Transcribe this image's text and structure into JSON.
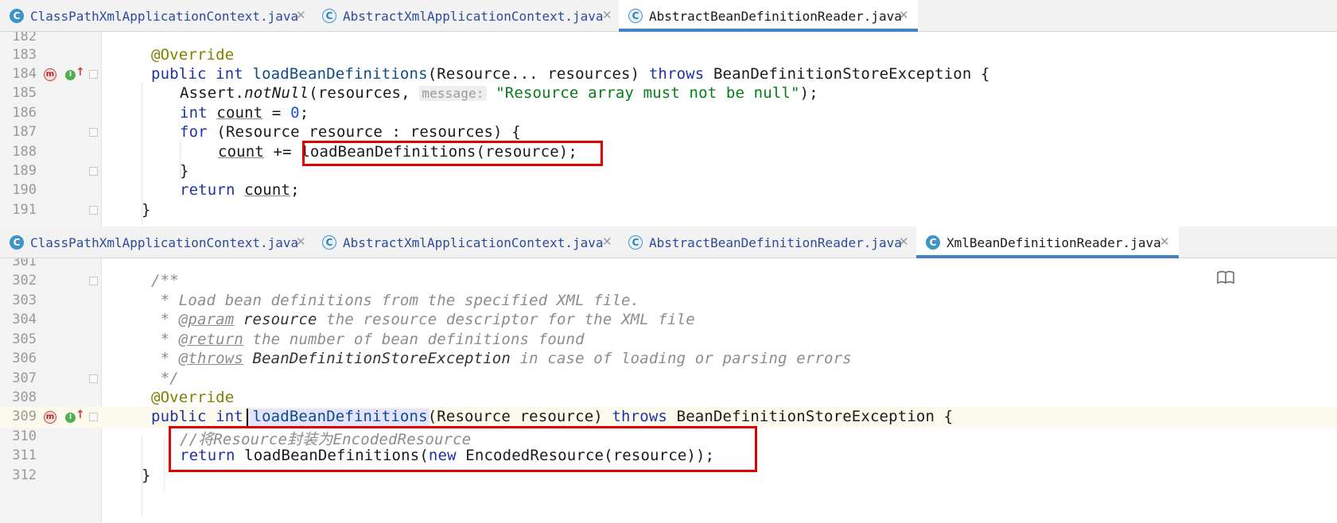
{
  "top_tabs": [
    {
      "label": "ClassPathXmlApplicationContext.java",
      "icon": "C",
      "active": false
    },
    {
      "label": "AbstractXmlApplicationContext.java",
      "icon": "C",
      "active": false
    },
    {
      "label": "AbstractBeanDefinitionReader.java",
      "icon": "C",
      "active": true
    }
  ],
  "bottom_tabs": [
    {
      "label": "ClassPathXmlApplicationContext.java",
      "icon": "C",
      "active": false
    },
    {
      "label": "AbstractXmlApplicationContext.java",
      "icon": "C",
      "active": false
    },
    {
      "label": "AbstractBeanDefinitionReader.java",
      "icon": "C",
      "active": false
    },
    {
      "label": "XmlBeanDefinitionReader.java",
      "icon": "C",
      "active": true
    }
  ],
  "close_glyph": "✕",
  "top_editor": {
    "line_numbers": [
      "182",
      "183",
      "184",
      "185",
      "186",
      "187",
      "188",
      "189",
      "190",
      "191"
    ],
    "code": {
      "l183_ann": "@Override",
      "l184_kw1": "public int ",
      "l184_fn": "loadBeanDefinitions",
      "l184_rest1": "(Resource... resources) ",
      "l184_kw2": "throws",
      "l184_rest2": " BeanDefinitionStoreException {",
      "l185_a": "Assert.",
      "l185_fn": "notNull",
      "l185_b": "(resources, ",
      "l185_hint": "message:",
      "l185_str": "\"Resource array must not be null\"",
      "l185_c": ");",
      "l186_kw": "int ",
      "l186_var": "count",
      "l186_eq": " = ",
      "l186_num": "0",
      "l186_semi": ";",
      "l187_kw": "for",
      "l187_rest": " (Resource resource : resources) {",
      "l188_var": "count",
      "l188_op": " += ",
      "l188_call": "loadBeanDefinitions(resource);",
      "l189": "}",
      "l190_kw": "return ",
      "l190_var": "count",
      "l190_semi": ";",
      "l191": "}"
    }
  },
  "bottom_editor": {
    "line_numbers": [
      "301",
      "302",
      "303",
      "304",
      "305",
      "306",
      "307",
      "308",
      "309",
      "310",
      "311",
      "312"
    ],
    "code": {
      "l302": "/**",
      "l303": " * Load bean definitions from the specified XML file.",
      "l304_a": " * ",
      "l304_tag": "@param",
      "l304_p": " resource",
      "l304_b": " the resource descriptor for the XML file",
      "l305_a": " * ",
      "l305_tag": "@return",
      "l305_b": " the number of bean definitions found",
      "l306_a": " * ",
      "l306_tag": "@throws",
      "l306_p": " BeanDefinitionStoreException",
      "l306_b": " in case of loading or parsing errors",
      "l307": " */",
      "l308_ann": "@Override",
      "l309_kw1": "public int ",
      "l309_fn": "loadBeanDefinitions",
      "l309_rest1": "(Resource resource) ",
      "l309_kw2": "throws",
      "l309_rest2": " BeanDefinitionStoreException {",
      "l310_cmt": "//将Resource封装为EncodedResource",
      "l311_kw": "return ",
      "l311_a": "loadBeanDefinitions(",
      "l311_kw2": "new",
      "l311_b": " EncodedResource(resource));",
      "l312": "}"
    }
  },
  "gutter_icons": {
    "method": "m",
    "implements": "I",
    "up_arrow": "↑",
    "down_arrow": "↓"
  },
  "reader_mode_icon": "book-icon"
}
